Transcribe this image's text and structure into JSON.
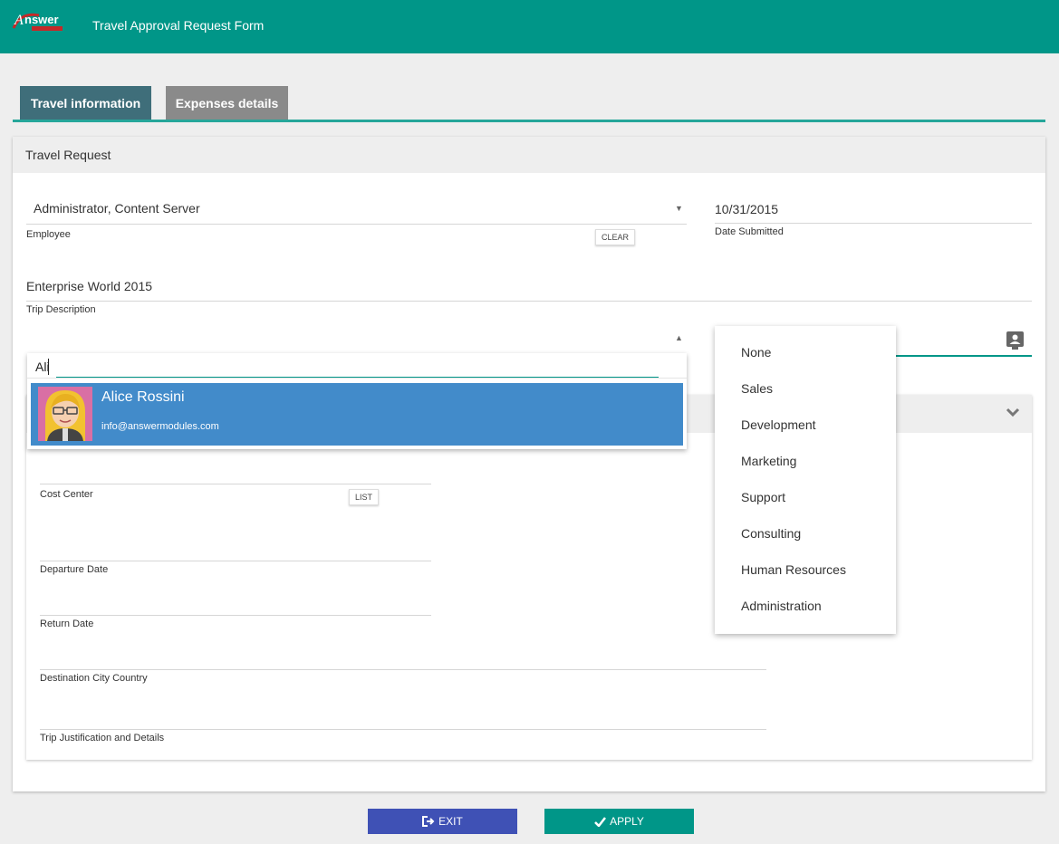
{
  "header": {
    "logo_text": "Answer modules",
    "title": "Travel Approval Request Form"
  },
  "tabs": [
    {
      "label": "Travel information",
      "active": true
    },
    {
      "label": "Expenses details",
      "active": false
    }
  ],
  "card": {
    "title": "Travel Request"
  },
  "fields": {
    "employee": {
      "value": "Administrator, Content Server",
      "label": "Employee",
      "clear_label": "CLEAR"
    },
    "date_submitted": {
      "value": "10/31/2015",
      "label": "Date Submitted"
    },
    "trip_description": {
      "value": "Enterprise World 2015",
      "label": "Trip Description"
    },
    "cost_center": {
      "label": "Cost Center",
      "list_label": "LIST"
    },
    "departure_date": {
      "label": "Departure Date"
    },
    "return_date": {
      "label": "Return Date"
    },
    "destination": {
      "label": "Destination City Country"
    },
    "justification": {
      "label": "Trip Justification and Details"
    }
  },
  "user_search": {
    "query": "Ali",
    "results": [
      {
        "name": "Alice Rossini",
        "email": "info@answermodules.com"
      }
    ]
  },
  "department_menu": [
    "None",
    "Sales",
    "Development",
    "Marketing",
    "Support",
    "Consulting",
    "Human Resources",
    "Administration"
  ],
  "buttons": {
    "exit": "EXIT",
    "apply": "APPLY"
  },
  "colors": {
    "primary": "#009688",
    "tab_active": "#3f6e7a",
    "tab_inactive": "#8a8a8a",
    "selection": "#428bca",
    "exit_button": "#3f51b5"
  },
  "icons": {
    "exit": "sign-out-icon",
    "apply": "check-icon",
    "contact": "contact-card-icon",
    "collapse": "chevron-down-icon"
  }
}
